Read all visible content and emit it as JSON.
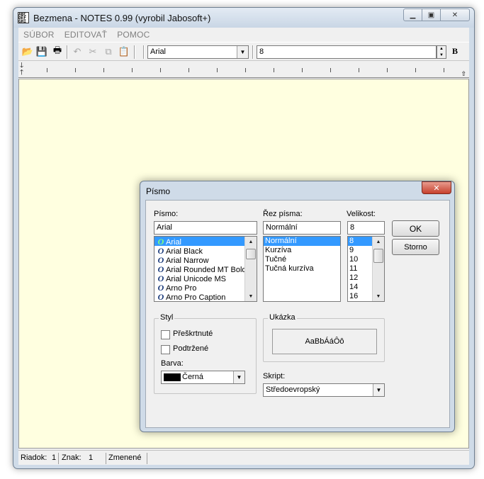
{
  "window": {
    "title": "Bezmena - NOTES 0.99 (vyrobil Jabosoft+)",
    "menu": [
      "SÚBOR",
      "EDITOVAŤ",
      "POMOC"
    ]
  },
  "toolbar": {
    "font_value": "Arial",
    "size_value": "8",
    "bold_label": "B"
  },
  "status": {
    "row_label": "Riadok:",
    "row_value": "1",
    "col_label": "Znak:",
    "col_value": "1",
    "state": "Zmenené"
  },
  "dialog": {
    "title": "Písmo",
    "font_label": "Písmo:",
    "font_value": "Arial",
    "style_label": "Řez písma:",
    "style_value": "Normální",
    "size_label": "Velikost:",
    "size_value": "8",
    "ok": "OK",
    "cancel": "Storno",
    "fonts": [
      "Arial",
      "Arial Black",
      "Arial Narrow",
      "Arial Rounded MT Bold",
      "Arial Unicode MS",
      "Arno Pro",
      "Arno Pro Caption"
    ],
    "font_glyph": "O",
    "styles": [
      "Normální",
      "Kurzíva",
      "Tučné",
      "Tučná kurzíva"
    ],
    "sizes": [
      "8",
      "9",
      "10",
      "11",
      "12",
      "14",
      "16"
    ],
    "effects": {
      "title": "Styl",
      "strike": "Přeškrtnuté",
      "underline": "Podtržené",
      "color_label": "Barva:",
      "color_value": "Černá",
      "color_hex": "#000000"
    },
    "sample": {
      "title": "Ukázka",
      "text": "AaBbÁáÔô"
    },
    "script_label": "Skript:",
    "script_value": "Středoevropský"
  },
  "colors": {
    "editor_bg": "#ffffe0",
    "selection": "#3399ff",
    "close_button": "#c7402c"
  }
}
